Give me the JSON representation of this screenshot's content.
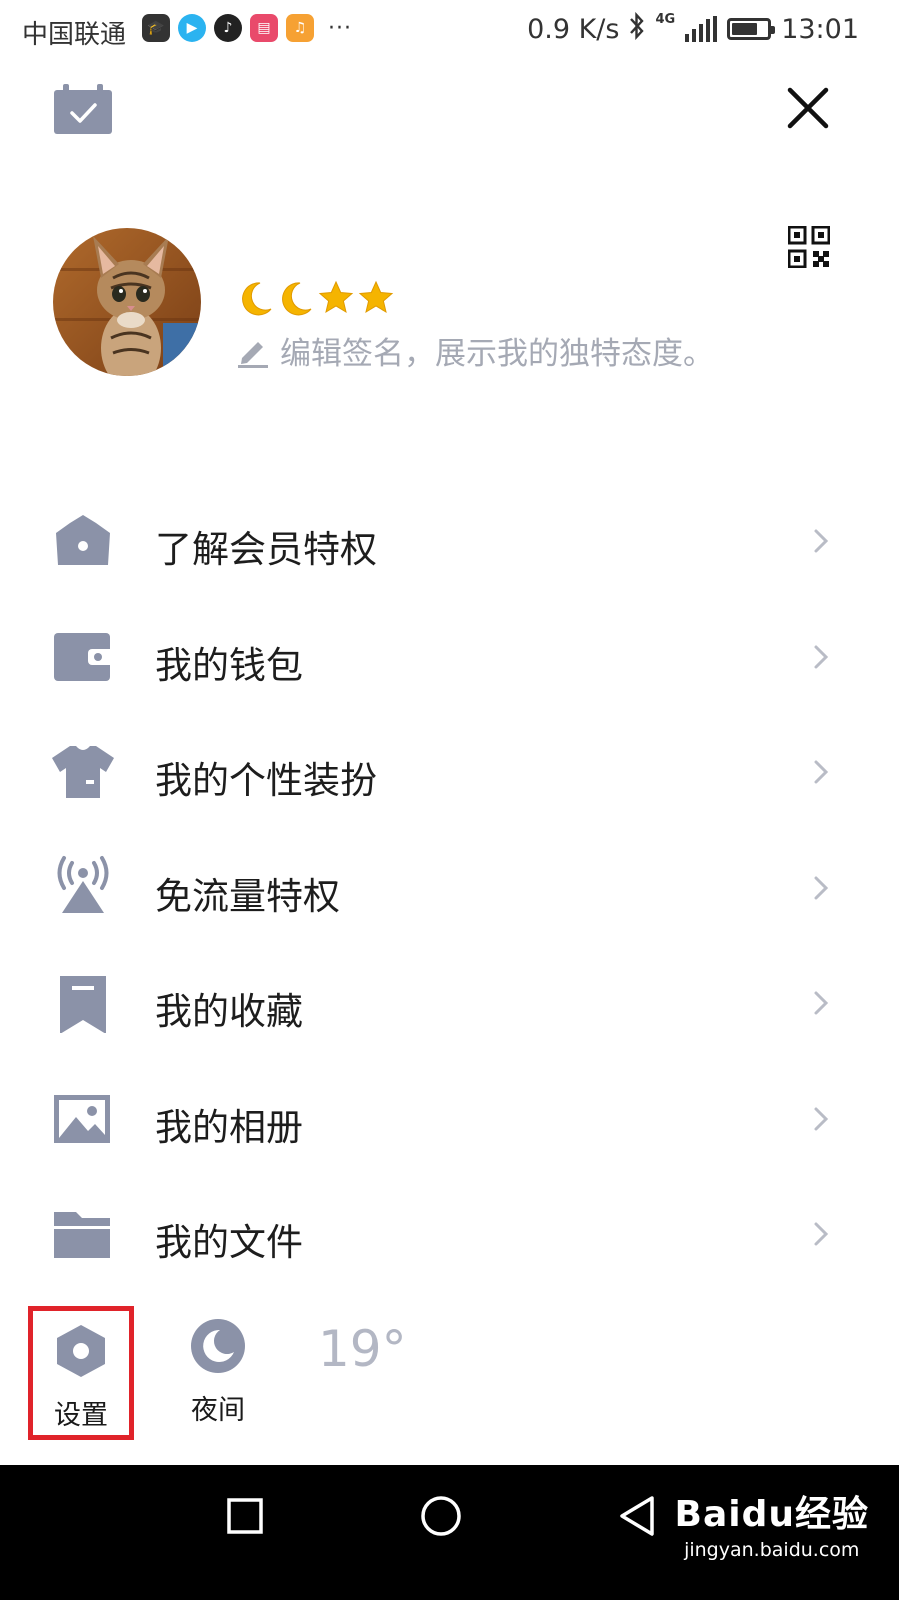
{
  "status_bar": {
    "carrier": "中国联通",
    "more_indicator": "···",
    "network_speed": "0.9 K/s",
    "network_type": "4G",
    "time": "13:01",
    "battery_level": 0.72,
    "app_icons": [
      "graduation-cap-icon",
      "video-app-icon",
      "tiktok-icon",
      "shop-app-icon",
      "music-app-icon"
    ]
  },
  "header": {
    "left_icon": "calendar-check-icon",
    "close_icon": "close-icon"
  },
  "profile": {
    "avatar": "cat-avatar",
    "badges": [
      "moon",
      "moon",
      "star",
      "star"
    ],
    "signature_placeholder": "编辑签名，展示我的独特态度。",
    "qr_icon": "qr-code-icon"
  },
  "menu": {
    "items": [
      {
        "label": "了解会员特权",
        "icon": "crown-icon"
      },
      {
        "label": "我的钱包",
        "icon": "wallet-icon"
      },
      {
        "label": "我的个性装扮",
        "icon": "tshirt-icon"
      },
      {
        "label": "免流量特权",
        "icon": "broadcast-tower-icon"
      },
      {
        "label": "我的收藏",
        "icon": "bookmark-icon"
      },
      {
        "label": "我的相册",
        "icon": "photo-icon"
      },
      {
        "label": "我的文件",
        "icon": "folder-icon"
      }
    ]
  },
  "bottom": {
    "settings_label": "设置",
    "night_label": "夜间",
    "temperature": "19°"
  },
  "navbar": {
    "watermark_main": "Baidu经验",
    "watermark_sub": "jingyan.baidu.com"
  },
  "colors": {
    "icon_gray": "#8b92a8",
    "highlight_red": "#e0232a",
    "badge_gold": "#f5b400"
  }
}
